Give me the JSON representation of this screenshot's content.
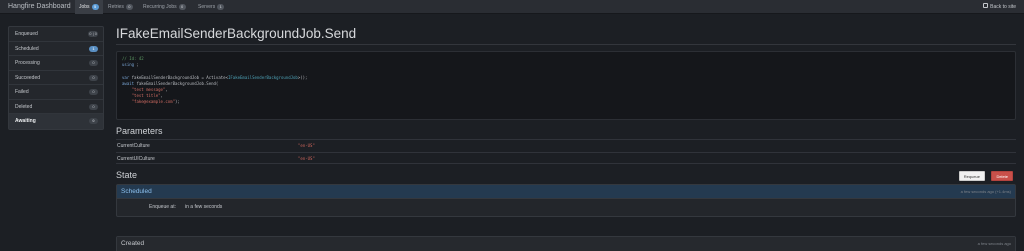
{
  "navbar": {
    "brand": "Hangfire Dashboard",
    "items": [
      {
        "label": "Jobs",
        "count": "5"
      },
      {
        "label": "Retries",
        "count": "0"
      },
      {
        "label": "Recurring Jobs",
        "count": "0"
      },
      {
        "label": "Servers",
        "count": "1"
      }
    ],
    "back_label": "Back to site"
  },
  "sidebar": {
    "items": [
      {
        "label": "Enqueued",
        "count": "0 | 0"
      },
      {
        "label": "Scheduled",
        "count": "1"
      },
      {
        "label": "Processing",
        "count": "0"
      },
      {
        "label": "Succeeded",
        "count": "0"
      },
      {
        "label": "Failed",
        "count": "0"
      },
      {
        "label": "Deleted",
        "count": "0"
      },
      {
        "label": "Awaiting",
        "count": "0"
      }
    ]
  },
  "job": {
    "title": "IFakeEmailSenderBackgroundJob.Send",
    "code": {
      "comment": "// Id: 42",
      "using_kw": "using",
      "using_rest": " ;",
      "var_kw": "var",
      "var_decl": " fakeEmailSenderBackgroundJob = Activate<",
      "type_name": "IFakeEmailSenderBackgroundJob",
      "var_end": ">();",
      "await_kw": "await",
      "await_rest": " fakeEmailSenderBackgroundJob.Send(",
      "arg1": "\"test message\"",
      "arg2": "\"test title\"",
      "arg3": "\"fake@example.com\"",
      "close": ");"
    }
  },
  "parameters": {
    "title": "Parameters",
    "rows": [
      {
        "name": "CurrentCulture",
        "value": "\"en-US\""
      },
      {
        "name": "CurrentUICulture",
        "value": "\"en-US\""
      }
    ]
  },
  "state": {
    "title": "State",
    "requeue_label": "Requeue",
    "delete_label": "Delete",
    "scheduled": {
      "name": "Scheduled",
      "time": "a few seconds ago (+1.4ms)",
      "enqueue_label": "Enqueue at:",
      "enqueue_value": "in a few seconds"
    },
    "created": {
      "name": "Created",
      "time": "a few seconds ago"
    }
  },
  "colors": {
    "accent": "#5b9bd5",
    "danger": "#c9504a",
    "string": "#d06b62"
  }
}
